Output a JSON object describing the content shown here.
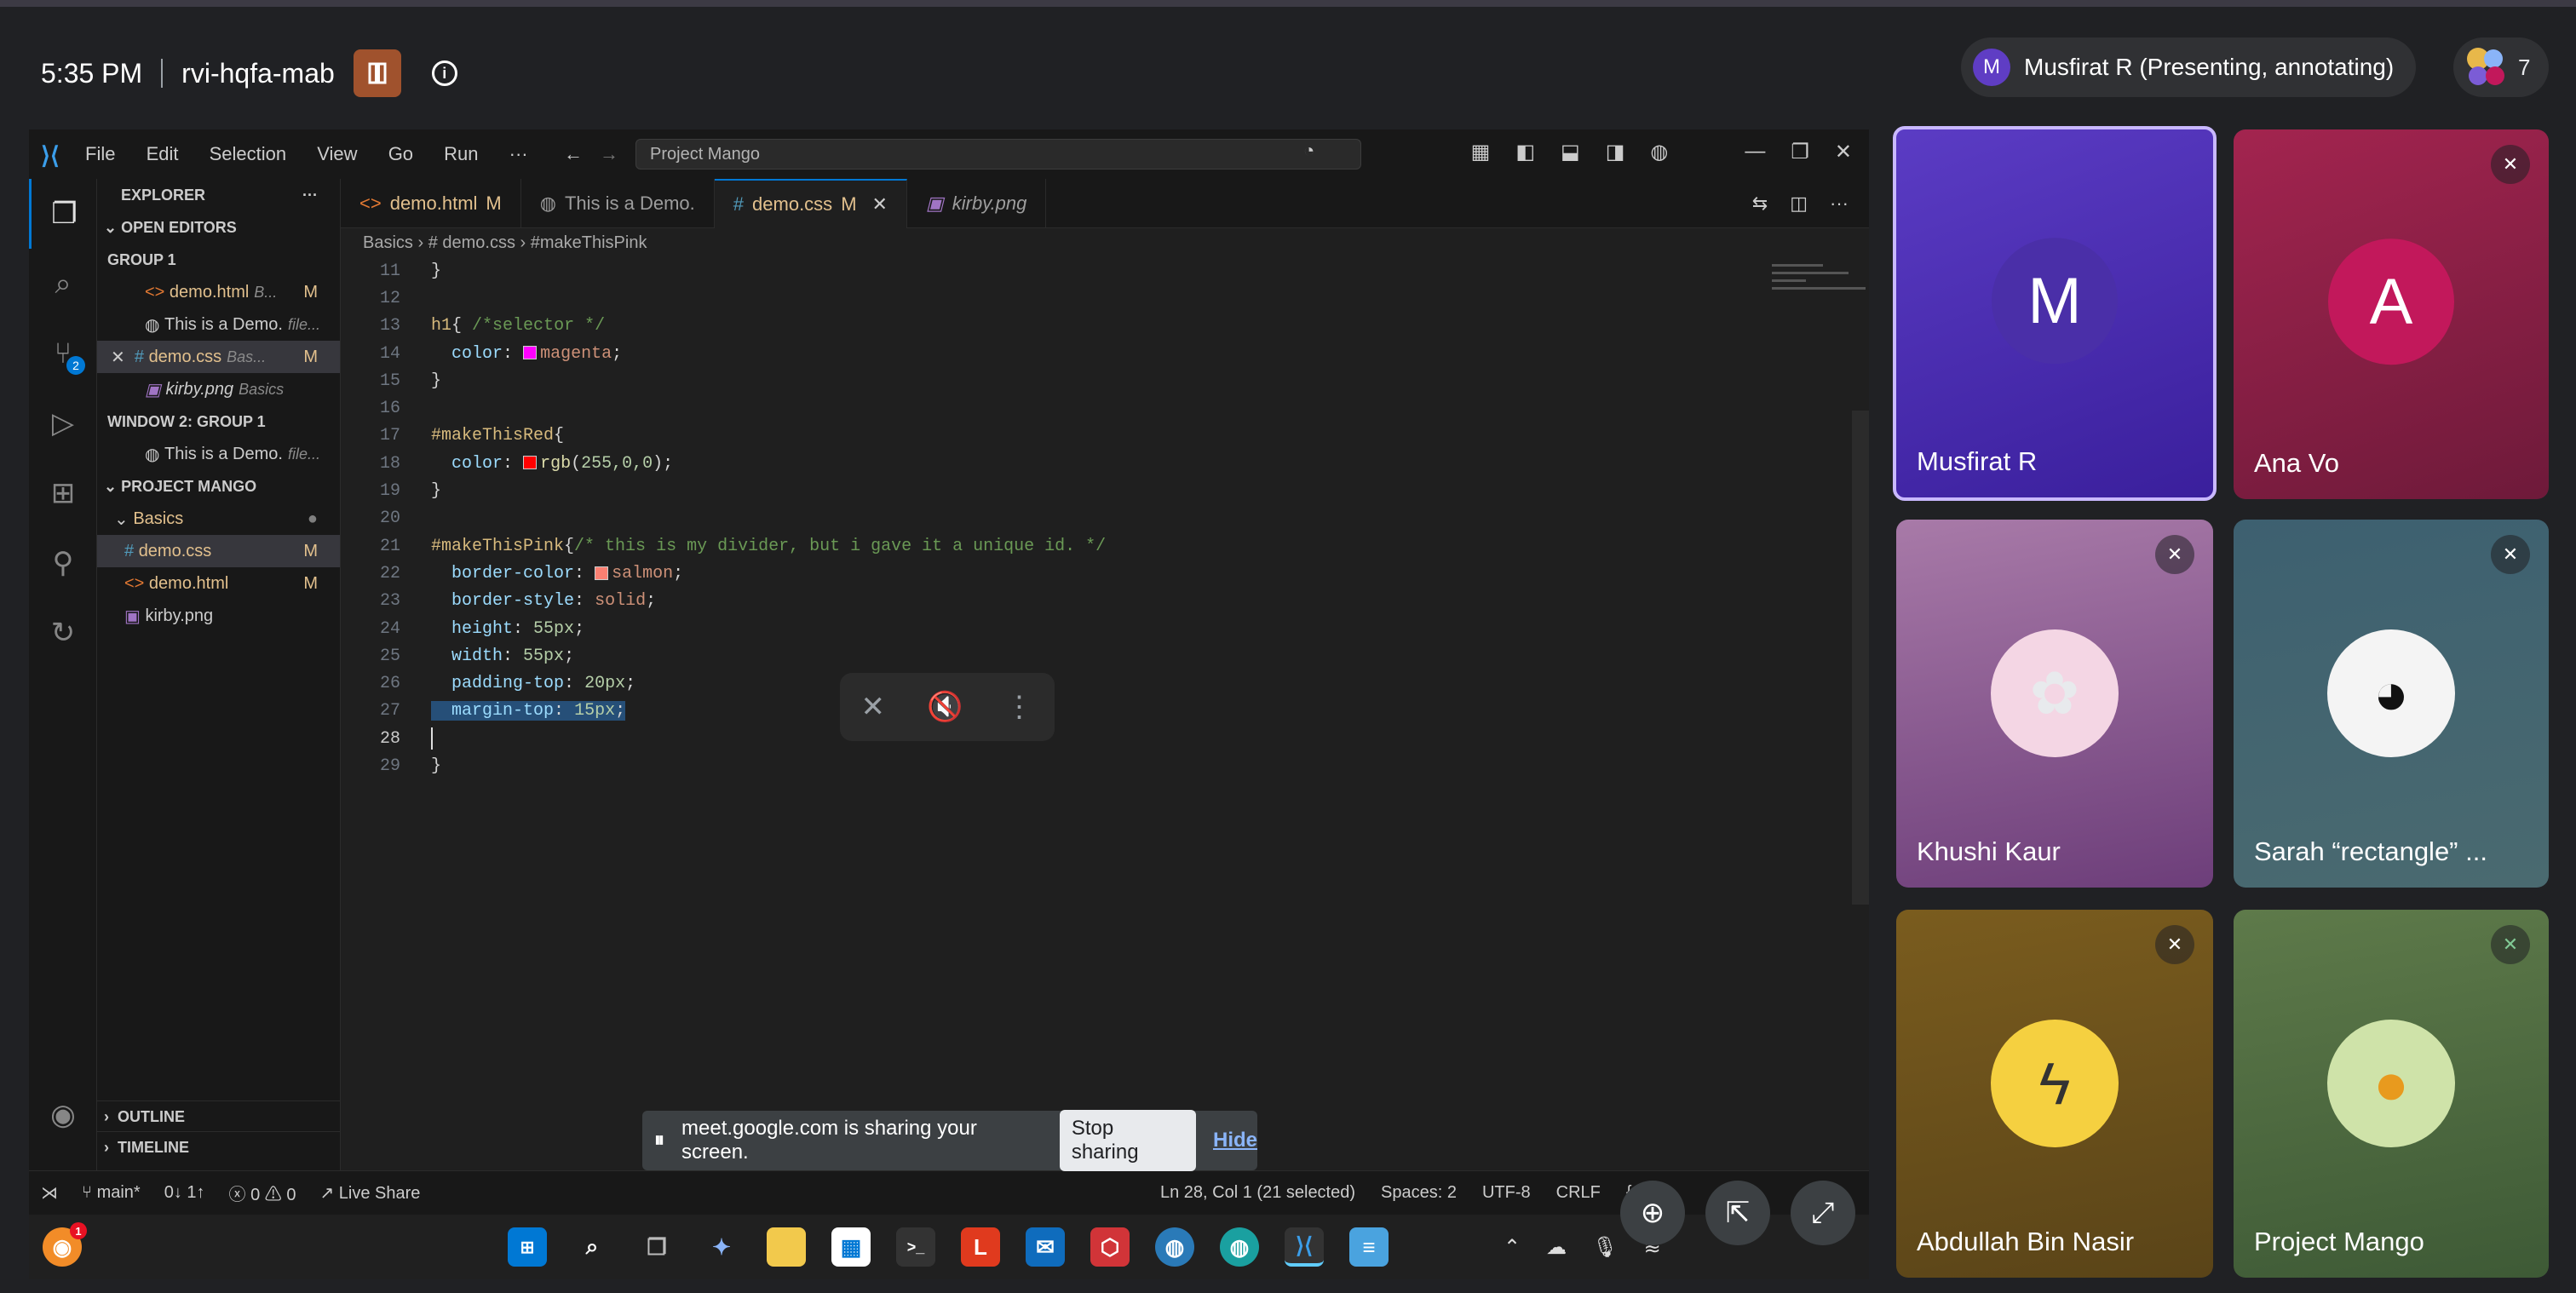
{
  "header": {
    "time": "5:35 PM",
    "meeting_code": "rvi-hqfa-mab",
    "presenter_pill": "Musfirat R (Presenting, annotating)",
    "presenter_initial": "M",
    "participant_count": "7"
  },
  "vscode": {
    "menu": [
      "File",
      "Edit",
      "Selection",
      "View",
      "Go",
      "Run",
      "···"
    ],
    "search_text": "Project Mango",
    "tabs": [
      {
        "label": "demo.html",
        "badge": "M",
        "icon": "<>"
      },
      {
        "label": "This is a Demo.",
        "badge": "",
        "icon": "◍"
      },
      {
        "label": "demo.css",
        "badge": "M",
        "icon": "#"
      },
      {
        "label": "kirby.png",
        "badge": "",
        "icon": "▣"
      }
    ],
    "breadcrumb": [
      "Basics",
      "# demo.css",
      "#makeThisPink"
    ],
    "explorer": {
      "title": "EXPLORER",
      "open_editors": "OPEN EDITORS",
      "group1": "GROUP 1",
      "group1_items": [
        {
          "name": "demo.html",
          "hint": "B...",
          "badge": "M"
        },
        {
          "name": "This is a Demo.",
          "hint": "file...",
          "badge": ""
        },
        {
          "name": "demo.css",
          "hint": "Bas...",
          "badge": "M"
        },
        {
          "name": "kirby.png",
          "hint": "Basics",
          "badge": ""
        }
      ],
      "window2": "WINDOW 2: GROUP 1",
      "window2_item": {
        "name": "This is a Demo.",
        "hint": "file..."
      },
      "project": "PROJECT MANGO",
      "folder": "Basics",
      "files": [
        {
          "name": "demo.css",
          "badge": "M"
        },
        {
          "name": "demo.html",
          "badge": "M"
        },
        {
          "name": "kirby.png",
          "badge": ""
        }
      ],
      "outline": "OUTLINE",
      "timeline": "TIMELINE"
    },
    "code_lines": [
      {
        "n": "11",
        "t": "}"
      },
      {
        "n": "12",
        "t": ""
      },
      {
        "n": "13",
        "t": "h1{ /*selector */"
      },
      {
        "n": "14",
        "t": "  color: magenta;"
      },
      {
        "n": "15",
        "t": "}"
      },
      {
        "n": "16",
        "t": ""
      },
      {
        "n": "17",
        "t": "#makeThisRed{"
      },
      {
        "n": "18",
        "t": "  color: rgb(255,0,0);"
      },
      {
        "n": "19",
        "t": "}"
      },
      {
        "n": "20",
        "t": ""
      },
      {
        "n": "21",
        "t": "#makeThisPink{/* this is my divider, but i gave it a unique id. */"
      },
      {
        "n": "22",
        "t": "  border-color: salmon;"
      },
      {
        "n": "23",
        "t": "  border-style: solid;"
      },
      {
        "n": "24",
        "t": "  height: 55px;"
      },
      {
        "n": "25",
        "t": "  width: 55px;"
      },
      {
        "n": "26",
        "t": "  padding-top: 20px;"
      },
      {
        "n": "27",
        "t": "  margin-top: 15px;"
      },
      {
        "n": "28",
        "t": ""
      },
      {
        "n": "29",
        "t": "}"
      }
    ],
    "status": {
      "branch": "main*",
      "sync": "0↓ 1↑",
      "problems": "0 ⚠ 0",
      "live_share": "Live Share",
      "position": "Ln 28, Col 1 (21 selected)",
      "spaces": "Spaces: 2",
      "encoding": "UTF-8",
      "eol": "CRLF",
      "lang": "{ }"
    }
  },
  "share_banner": {
    "text": "meet.google.com is sharing your screen.",
    "stop": "Stop sharing",
    "hide": "Hide"
  },
  "participants": [
    {
      "name": "Musfirat R",
      "initial": "M"
    },
    {
      "name": "Ana Vo",
      "initial": "A"
    },
    {
      "name": "Khushi Kaur"
    },
    {
      "name": "Sarah “rectangle” ..."
    },
    {
      "name": "Abdullah Bin Nasir"
    },
    {
      "name": "Project Mango"
    }
  ],
  "colors": {
    "accent": "#0078d4",
    "presenter_tile": "#4a2fa8",
    "ana_tile": "#8e1a3e"
  }
}
